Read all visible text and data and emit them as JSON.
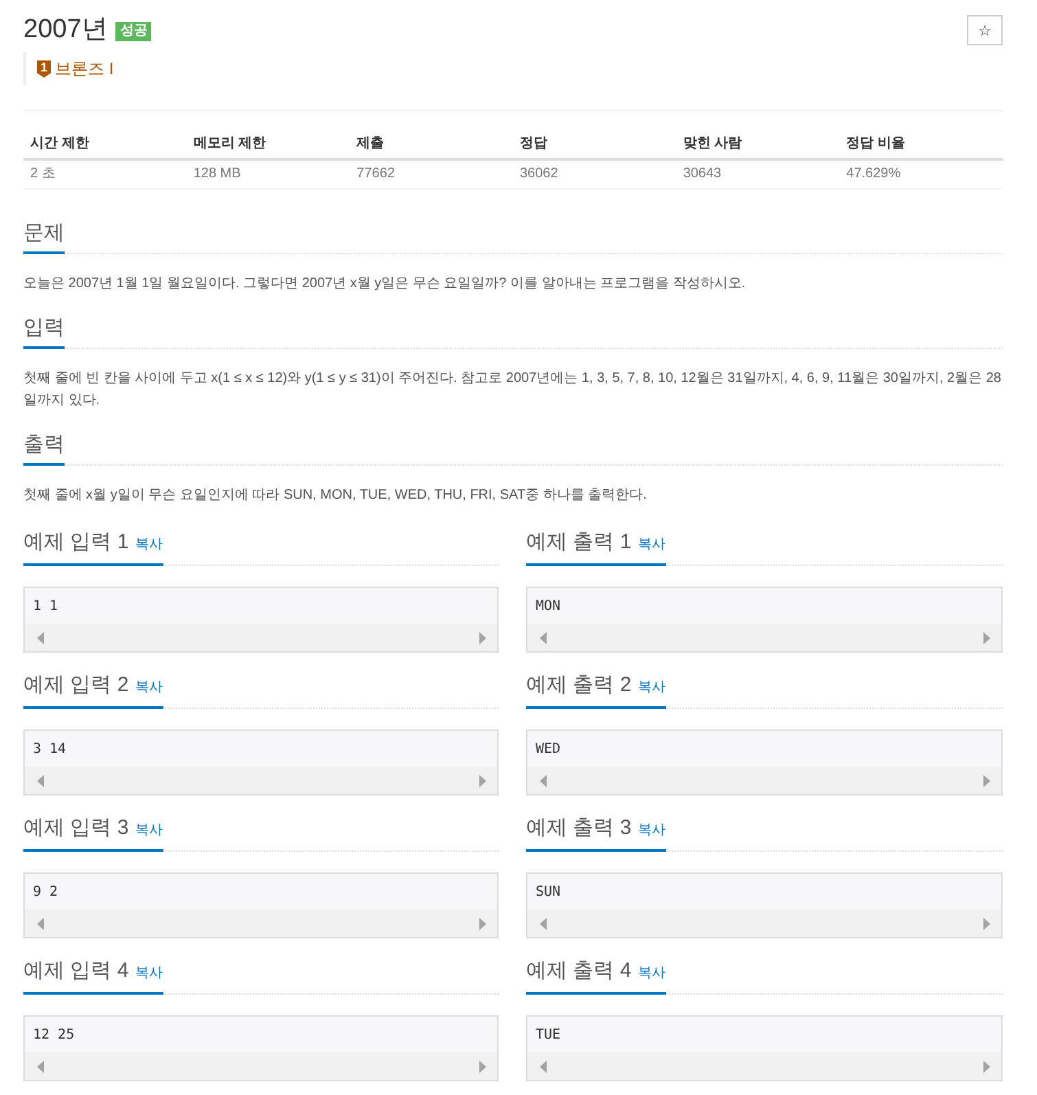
{
  "problem": {
    "title": "2007년",
    "result_badge": "성공",
    "star_button": "☆"
  },
  "tier": {
    "number": "1",
    "name": "브론즈 I"
  },
  "info_table": {
    "columns": [
      "시간 제한",
      "메모리 제한",
      "제출",
      "정답",
      "맞힌 사람",
      "정답 비율"
    ],
    "rows": [
      [
        "2 초",
        "128 MB",
        "77662",
        "36062",
        "30643",
        "47.629%"
      ]
    ]
  },
  "sections": [
    {
      "heading": "문제",
      "text": "오늘은 2007년 1월 1일 월요일이다. 그렇다면 2007년 x월 y일은 무슨 요일일까? 이를 알아내는 프로그램을 작성하시오."
    },
    {
      "heading": "입력",
      "text": "첫째 줄에 빈 칸을 사이에 두고 x(1 ≤ x ≤ 12)와 y(1 ≤ y ≤ 31)이 주어진다. 참고로 2007년에는 1, 3, 5, 7, 8, 10, 12월은 31일까지, 4, 6, 9, 11월은 30일까지, 2월은 28일까지 있다."
    },
    {
      "heading": "출력",
      "text": "첫째 줄에 x월 y일이 무슨 요일인지에 따라 SUN, MON, TUE, WED, THU, FRI, SAT중 하나를 출력한다."
    }
  ],
  "samples": [
    {
      "title": "예제 입력 1",
      "copy": "복사",
      "data": "1 1"
    },
    {
      "title": "예제 출력 1",
      "copy": "복사",
      "data": "MON"
    },
    {
      "title": "예제 입력 2",
      "copy": "복사",
      "data": "3 14"
    },
    {
      "title": "예제 출력 2",
      "copy": "복사",
      "data": "WED"
    },
    {
      "title": "예제 입력 3",
      "copy": "복사",
      "data": "9 2"
    },
    {
      "title": "예제 출력 3",
      "copy": "복사",
      "data": "SUN"
    },
    {
      "title": "예제 입력 4",
      "copy": "복사",
      "data": "12 25"
    },
    {
      "title": "예제 출력 4",
      "copy": "복사",
      "data": "TUE"
    }
  ]
}
